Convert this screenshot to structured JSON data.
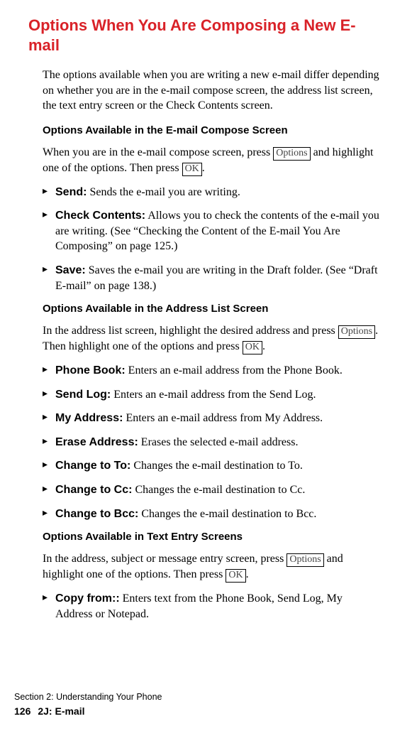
{
  "heading": "Options When You Are Composing a New E-mail",
  "intro": "The options available when you are writing a new e-mail differ depending on whether you are in the e-mail compose screen, the address list screen, the text entry screen or the Check Contents screen.",
  "keys": {
    "options": "Options",
    "ok": "OK"
  },
  "section1": {
    "heading": "Options Available in the E-mail Compose Screen",
    "intro_a": "When you are in the e-mail compose screen, press ",
    "intro_b": " and highlight one of the options. Then press ",
    "intro_c": ".",
    "items": [
      {
        "label": "Send:",
        "text": " Sends the e-mail you are writing."
      },
      {
        "label": "Check Contents:",
        "text": " Allows you to check the contents of the e-mail you are writing. (See “Checking the Content of the E-mail You Are Composing” on page 125.)"
      },
      {
        "label": "Save:",
        "text": " Saves the e-mail you are writing in the Draft folder. (See “Draft E-mail” on page 138.)"
      }
    ]
  },
  "section2": {
    "heading": "Options Available in the Address List Screen",
    "intro_a": "In the address list screen, highlight the desired address and press ",
    "intro_b": ". Then highlight one of the options and press ",
    "intro_c": ".",
    "items": [
      {
        "label": "Phone Book:",
        "text": " Enters an e-mail address from the Phone Book."
      },
      {
        "label": "Send Log:",
        "text": " Enters an e-mail address from the Send Log."
      },
      {
        "label": "My Address:",
        "text": " Enters an e-mail address from My Address."
      },
      {
        "label": "Erase Address:",
        "text": " Erases the selected e-mail address."
      },
      {
        "label": "Change to To:",
        "text": " Changes the e-mail destination to To."
      },
      {
        "label": "Change to Cc:",
        "text": " Changes the e-mail destination to Cc."
      },
      {
        "label": "Change to Bcc:",
        "text": " Changes the e-mail destination to Bcc."
      }
    ]
  },
  "section3": {
    "heading": "Options Available in Text Entry Screens",
    "intro_a": "In the address, subject or message entry screen, press ",
    "intro_b": " and highlight one of the options. Then press ",
    "intro_c": ".",
    "items": [
      {
        "label": "Copy from::",
        "text": " Enters text from the Phone Book, Send Log, My Address or Notepad."
      }
    ]
  },
  "footer": {
    "section": "Section 2: Understanding Your Phone",
    "page_num": "126",
    "chapter": "2J: E-mail"
  }
}
